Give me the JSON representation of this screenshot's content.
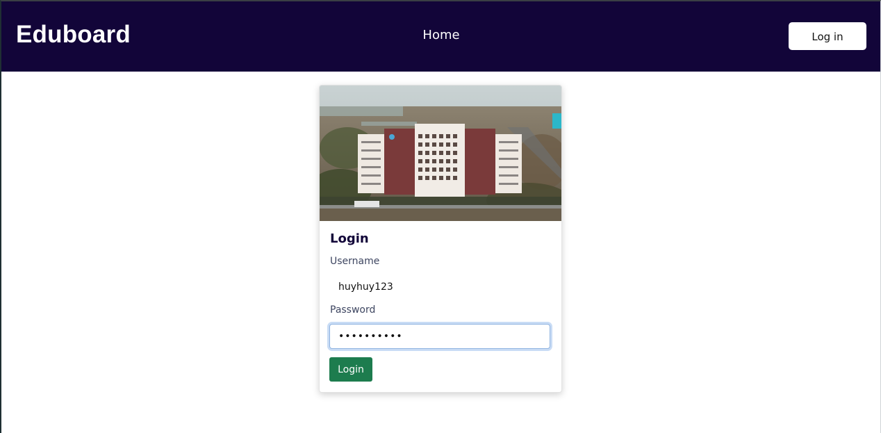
{
  "navbar": {
    "brand": "Eduboard",
    "home_link": "Home",
    "login_button": "Log in",
    "background": "#120539"
  },
  "login_card": {
    "image_alt": "University campus aerial view",
    "title": "Login",
    "username_label": "Username",
    "username_value": "huyhuy123",
    "password_label": "Password",
    "password_value": "••••••••••",
    "submit_label": "Login",
    "submit_color": "#1d7c4e"
  }
}
